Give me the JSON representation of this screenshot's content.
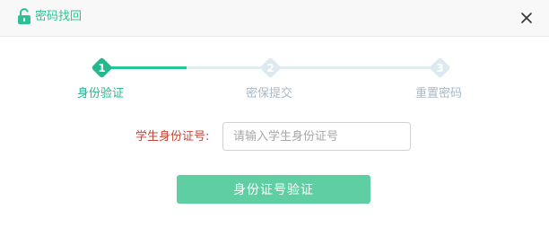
{
  "dialog": {
    "title": "密码找回",
    "icons": {
      "title_icon": "unlock-padlock-icon",
      "close_icon": "close-icon"
    }
  },
  "steps": [
    {
      "number": "1",
      "label": "身份验证",
      "status": "active"
    },
    {
      "number": "2",
      "label": "密保提交",
      "status": "pending"
    },
    {
      "number": "3",
      "label": "重置密码",
      "status": "pending"
    }
  ],
  "progress_fraction": 0.25,
  "form": {
    "student_id_label": "学生身份证号:",
    "student_id_placeholder": "请输入学生身份证号",
    "student_id_value": ""
  },
  "submit_label": "身份证号验证",
  "colors": {
    "accent": "#28c599",
    "title": "#2cc295",
    "label_red": "#c2473b",
    "pending": "#dbe9f0",
    "button": "#5fcfa3"
  }
}
